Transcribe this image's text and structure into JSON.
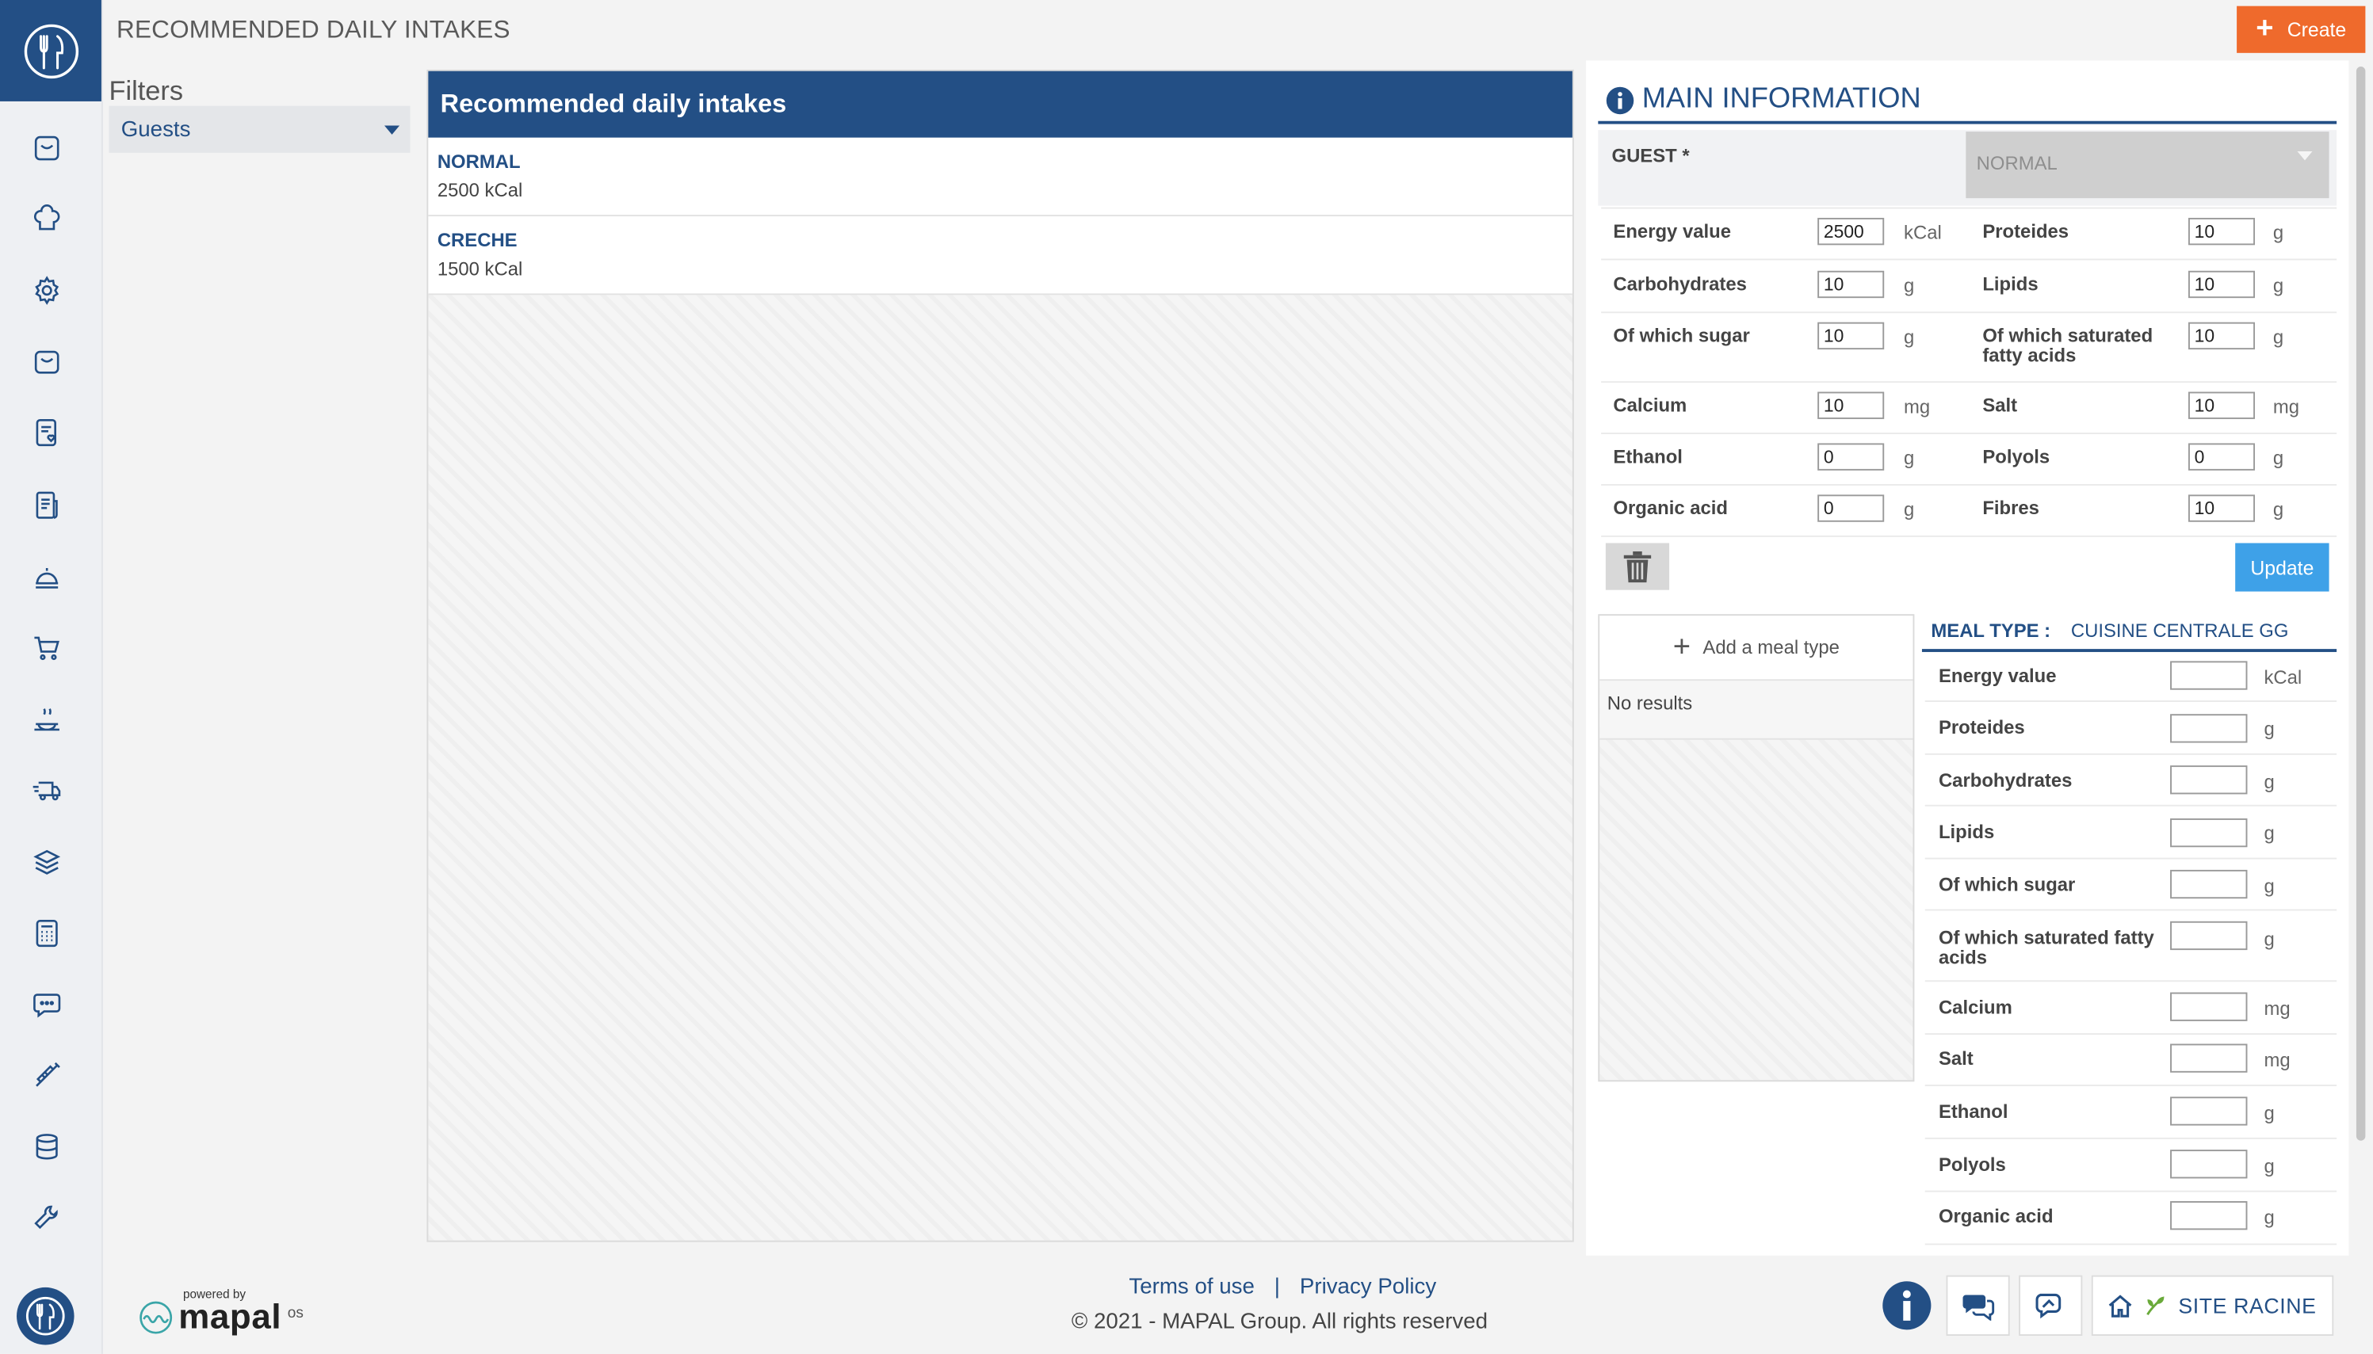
{
  "header": {
    "title": "RECOMMENDED DAILY INTAKES",
    "create_label": "Create"
  },
  "filters": {
    "title": "Filters",
    "selected": "Guests"
  },
  "list": {
    "header": "Recommended daily intakes",
    "items": [
      {
        "name": "NORMAL",
        "kcal": "2500 kCal"
      },
      {
        "name": "CRECHE",
        "kcal": "1500 kCal"
      }
    ]
  },
  "main_info": {
    "title": "MAIN INFORMATION",
    "guest_label": "GUEST *",
    "guest_value": "NORMAL",
    "nutrients": [
      {
        "label": "Energy value",
        "value": "2500",
        "unit": "kCal"
      },
      {
        "label": "Proteides",
        "value": "10",
        "unit": "g"
      },
      {
        "label": "Carbohydrates",
        "value": "10",
        "unit": "g"
      },
      {
        "label": "Lipids",
        "value": "10",
        "unit": "g"
      },
      {
        "label": "Of which sugar",
        "value": "10",
        "unit": "g"
      },
      {
        "label": "Of which saturated fatty acids",
        "value": "10",
        "unit": "g"
      },
      {
        "label": "Calcium",
        "value": "10",
        "unit": "mg"
      },
      {
        "label": "Salt",
        "value": "10",
        "unit": "mg"
      },
      {
        "label": "Ethanol",
        "value": "0",
        "unit": "g"
      },
      {
        "label": "Polyols",
        "value": "0",
        "unit": "g"
      },
      {
        "label": "Organic acid",
        "value": "0",
        "unit": "g"
      },
      {
        "label": "Fibres",
        "value": "10",
        "unit": "g"
      }
    ],
    "update_label": "Update"
  },
  "meal_list": {
    "add_label": "Add a meal type",
    "empty_label": "No results"
  },
  "meal_type": {
    "key": "MEAL TYPE :",
    "value": "CUISINE CENTRALE GG",
    "fields": [
      {
        "label": "Energy value",
        "value": "",
        "unit": "kCal"
      },
      {
        "label": "Proteides",
        "value": "",
        "unit": "g"
      },
      {
        "label": "Carbohydrates",
        "value": "",
        "unit": "g"
      },
      {
        "label": "Lipids",
        "value": "",
        "unit": "g"
      },
      {
        "label": "Of which sugar",
        "value": "",
        "unit": "g"
      },
      {
        "label": "Of which saturated fatty acids",
        "value": "",
        "unit": "g"
      },
      {
        "label": "Calcium",
        "value": "",
        "unit": "mg"
      },
      {
        "label": "Salt",
        "value": "",
        "unit": "mg"
      },
      {
        "label": "Ethanol",
        "value": "",
        "unit": "g"
      },
      {
        "label": "Polyols",
        "value": "",
        "unit": "g"
      },
      {
        "label": "Organic acid",
        "value": "",
        "unit": "g"
      }
    ]
  },
  "footer": {
    "powered_by": "powered by",
    "brand": "mapal",
    "brand_suffix": "os",
    "terms": "Terms of use",
    "separator": "|",
    "privacy": "Privacy Policy",
    "copyright": "© 2021 - MAPAL Group. All rights reserved",
    "site": "SITE RACINE"
  },
  "sidebar": {
    "icons": [
      "inbox-icon",
      "chef-hat-icon",
      "gear-icon",
      "shopping-bag-icon",
      "recipe-heart-icon",
      "document-icon",
      "cloche-icon",
      "cart-icon",
      "hot-dish-icon",
      "delivery-truck-icon",
      "layers-icon",
      "calculator-icon",
      "chat-icon",
      "syringe-icon",
      "database-icon",
      "wrench-icon"
    ]
  },
  "colors": {
    "brand": "#234f85",
    "accent_orange": "#ef6a2c",
    "update_blue": "#3ea1e8"
  }
}
